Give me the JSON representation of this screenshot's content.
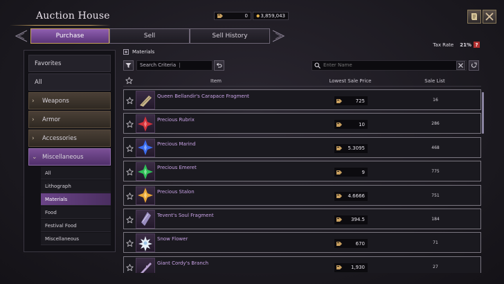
{
  "app": {
    "title": "Auction House"
  },
  "currency": {
    "silver": "0",
    "gold": "3,859,043"
  },
  "tabs": [
    {
      "label": "Purchase",
      "active": true
    },
    {
      "label": "Sell",
      "active": false
    },
    {
      "label": "Sell History",
      "active": false
    }
  ],
  "tax": {
    "label": "Tax Rate",
    "value": "21%",
    "help": "?"
  },
  "sidebar": {
    "favorites": "Favorites",
    "all": "All",
    "categories": [
      {
        "label": "Weapons",
        "chevron": "›"
      },
      {
        "label": "Armor",
        "chevron": "›"
      },
      {
        "label": "Accessories",
        "chevron": "›"
      },
      {
        "label": "Miscellaneous",
        "chevron": "⌄"
      }
    ],
    "subcategories": [
      {
        "label": "All"
      },
      {
        "label": "Lithograph"
      },
      {
        "label": "Materials",
        "active": true
      },
      {
        "label": "Food"
      },
      {
        "label": "Festival Food"
      },
      {
        "label": "Miscellaneous"
      }
    ]
  },
  "breadcrumb": "Materials",
  "search": {
    "criteria": "Search Criteria",
    "name_placeholder": "Enter Name"
  },
  "columns": {
    "item": "Item",
    "price": "Lowest Sale Price",
    "sale": "Sale List"
  },
  "items": [
    {
      "name": "Queen Bellandir's Carapace Fragment",
      "price": "725",
      "sale": "16",
      "icon": "carapace-fragment-icon",
      "color": "#c8b48a"
    },
    {
      "name": "Precious Rubrix",
      "price": "10",
      "sale": "286",
      "icon": "red-gem-icon",
      "color": "#d3333b"
    },
    {
      "name": "Precious Marind",
      "price": "5.3095",
      "sale": "468",
      "icon": "blue-gem-icon",
      "color": "#3a6cf0"
    },
    {
      "name": "Precious Emeret",
      "price": "9",
      "sale": "775",
      "icon": "green-gem-icon",
      "color": "#2fbf58"
    },
    {
      "name": "Precious Stalon",
      "price": "4.6666",
      "sale": "751",
      "icon": "amber-gem-icon",
      "color": "#e8a636"
    },
    {
      "name": "Tevent's Soul Fragment",
      "price": "394.5",
      "sale": "184",
      "icon": "soul-fragment-icon",
      "color": "#9a8cc0"
    },
    {
      "name": "Snow Flower",
      "price": "670",
      "sale": "71",
      "icon": "snow-flower-icon",
      "color": "#e6f0fa"
    },
    {
      "name": "Giant Cordy's Branch",
      "price": "1,930",
      "sale": "27",
      "icon": "branch-icon",
      "color": "#b9a2d0"
    }
  ]
}
